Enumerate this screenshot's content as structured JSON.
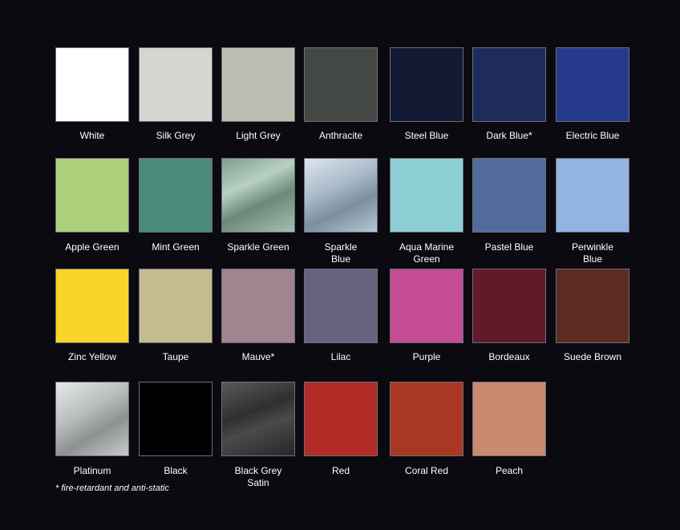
{
  "swatches": [
    {
      "label": "White",
      "color": "#ffffff"
    },
    {
      "label": "Silk Grey",
      "color": "#d6d5d1"
    },
    {
      "label": "Light Grey",
      "color": "#bcbeb2"
    },
    {
      "label": "Anthracite",
      "color": "#444845"
    },
    {
      "label": "Steel Blue",
      "color": "#121a33"
    },
    {
      "label": "Dark Blue*",
      "color": "#1f2b5b"
    },
    {
      "label": "Electric Blue",
      "color": "#263a8d"
    },
    {
      "label": "Apple Green",
      "color": "#acd17a"
    },
    {
      "label": "Mint Green",
      "color": "#4a8a78"
    },
    {
      "label": "Sparkle Green",
      "color": "#8eaa98"
    },
    {
      "label": "Sparkle Blue",
      "color": "#a7b8c7"
    },
    {
      "label": "Aqua Marine Green",
      "color": "#8ecfd5"
    },
    {
      "label": "Pastel Blue",
      "color": "#516c9c"
    },
    {
      "label": "Perwinkle Blue",
      "color": "#93b3e0"
    },
    {
      "label": "Zinc Yellow",
      "color": "#f8d52a"
    },
    {
      "label": "Taupe",
      "color": "#c6bb90"
    },
    {
      "label": "Mauve*",
      "color": "#a08490"
    },
    {
      "label": "Lilac",
      "color": "#666381"
    },
    {
      "label": "Purple",
      "color": "#c64c96"
    },
    {
      "label": "Bordeaux",
      "color": "#621a28"
    },
    {
      "label": "Suede Brown",
      "color": "#5c2c20"
    },
    {
      "label": "Platinum",
      "color": "#c2c4c4"
    },
    {
      "label": "Black",
      "color": "#000000"
    },
    {
      "label": "Black Grey Satin",
      "color": "#3c3c3c"
    },
    {
      "label": "Red",
      "color": "#b22a25"
    },
    {
      "label": "Coral Red",
      "color": "#aa3722"
    },
    {
      "label": "Peach",
      "color": "#c98a70"
    }
  ],
  "footnote": "* fire-retardant and anti-static"
}
